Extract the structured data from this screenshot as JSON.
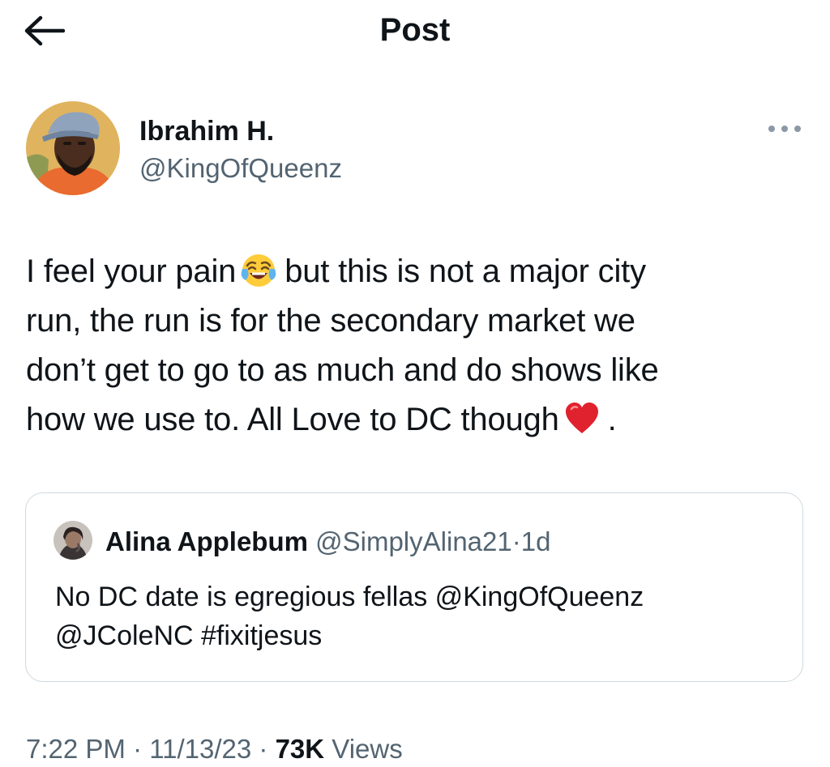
{
  "header": {
    "back_icon": "arrow-left-icon",
    "title": "Post"
  },
  "author": {
    "display_name": "Ibrahim H.",
    "handle": "@KingOfQueenz",
    "more_icon": "more-horizontal-icon"
  },
  "tweet": {
    "line1_before": "I feel your pain",
    "line1_after": "but this is not a major city",
    "line2": "run, the run is for the secondary market we",
    "line3": "don’t get to go to as much and do shows like",
    "line4_before": "how we use to. All Love to DC though",
    "line4_after": ".",
    "emoji_1": "face-with-tears-of-joy",
    "emoji_2": "red-heart"
  },
  "quote": {
    "name": "Alina Applebum",
    "handle": "@SimplyAlina21",
    "separator": "·",
    "time": "1d",
    "text_line1": "No DC date is egregious fellas @KingOfQueenz",
    "text_line2": "@JColeNC #fixitjesus"
  },
  "meta": {
    "time": "7:22 PM",
    "sep1": " · ",
    "date": "11/13/23",
    "sep2": " · ",
    "views_count": "73K",
    "views_label": " Views"
  },
  "colors": {
    "text": "#0f1419",
    "secondary": "#536471",
    "border": "#cfd9de"
  }
}
